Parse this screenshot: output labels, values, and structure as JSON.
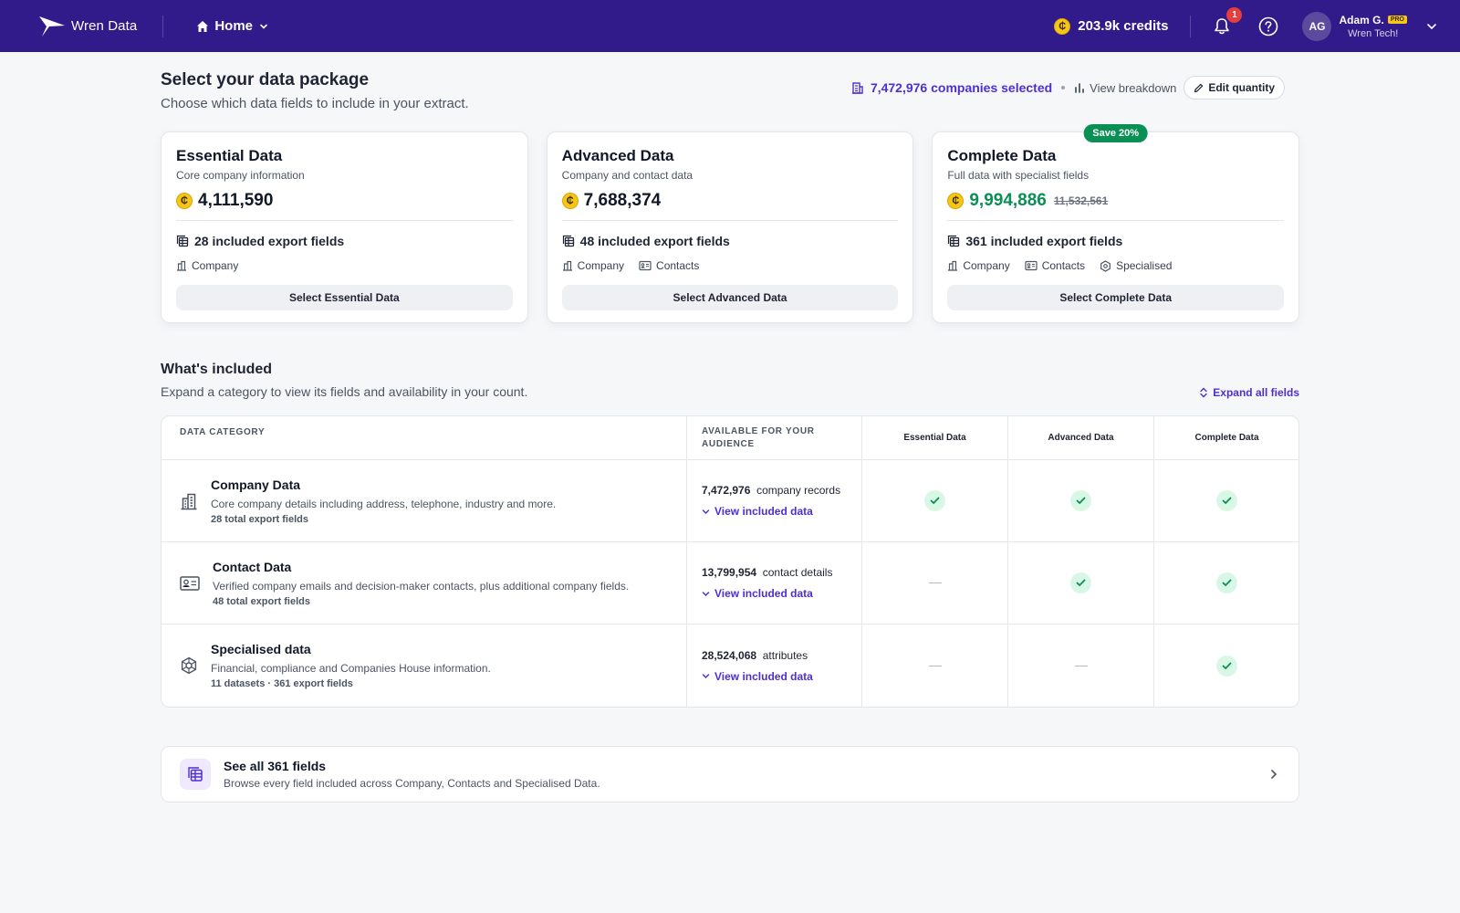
{
  "header": {
    "brand": "Wren Data",
    "nav": {
      "home_label": "Home"
    },
    "credits": {
      "coin_symbol": "₵",
      "label": "203.9k credits"
    },
    "notifications": {
      "count": "1"
    },
    "user": {
      "initials": "AG",
      "name": "Adam G.",
      "badge": "PRO",
      "company": "Wren Tech!"
    }
  },
  "page": {
    "title": "Select your data package",
    "subtitle": "Choose which data fields to include in your extract.",
    "selection": {
      "count_label": "7,472,976 companies selected",
      "breakdown_label": "View breakdown",
      "edit_label": "Edit quantity"
    }
  },
  "packages": [
    {
      "title": "Essential Data",
      "subtitle": "Core company information",
      "price": "4,111,590",
      "fields": "28 included export fields",
      "tags": [
        "Company"
      ],
      "button": "Select Essential Data"
    },
    {
      "title": "Advanced Data",
      "subtitle": "Company and contact data",
      "price": "7,688,374",
      "fields": "48 included export fields",
      "tags": [
        "Company",
        "Contacts"
      ],
      "button": "Select Advanced Data"
    },
    {
      "title": "Complete Data",
      "subtitle": "Full data with specialist fields",
      "price": "9,994,886",
      "old_price": "11,532,561",
      "badge": "Save 20%",
      "fields": "361 included export fields",
      "tags": [
        "Company",
        "Contacts",
        "Specialised"
      ],
      "button": "Select Complete Data"
    }
  ],
  "included": {
    "title": "What's included",
    "subtitle": "Expand a category to view its fields and availability in your count.",
    "expand_label": "Expand all fields",
    "columns": [
      "Data category",
      "Available for your audience",
      "Essential Data",
      "Advanced Data",
      "Complete Data"
    ],
    "view_label": "View included data",
    "rows": [
      {
        "title": "Company Data",
        "description": "Core company details including address, telephone, industry and more.",
        "fields": "28 total export fields",
        "count": "7,472,976",
        "unit": "company records",
        "essential": true,
        "advanced": true,
        "complete": true
      },
      {
        "title": "Contact Data",
        "description": "Verified company emails and decision-maker contacts, plus additional company fields.",
        "fields": "48 total export fields",
        "count": "13,799,954",
        "unit": "contact details",
        "essential": false,
        "advanced": true,
        "complete": true
      },
      {
        "title": "Specialised data",
        "description": "Financial, compliance and Companies House information.",
        "fields": "11 datasets · 361 export fields",
        "count": "28,524,068",
        "unit": "attributes",
        "essential": false,
        "advanced": false,
        "complete": true
      }
    ]
  },
  "see_all": {
    "title": "See all 361 fields",
    "subtitle": "Browse every field included across Company, Contacts and Specialised Data."
  },
  "colors": {
    "topbar": "#311a8a",
    "accent": "#4f2fd1",
    "green": "#0a8f55",
    "coin": "#f5c518"
  }
}
